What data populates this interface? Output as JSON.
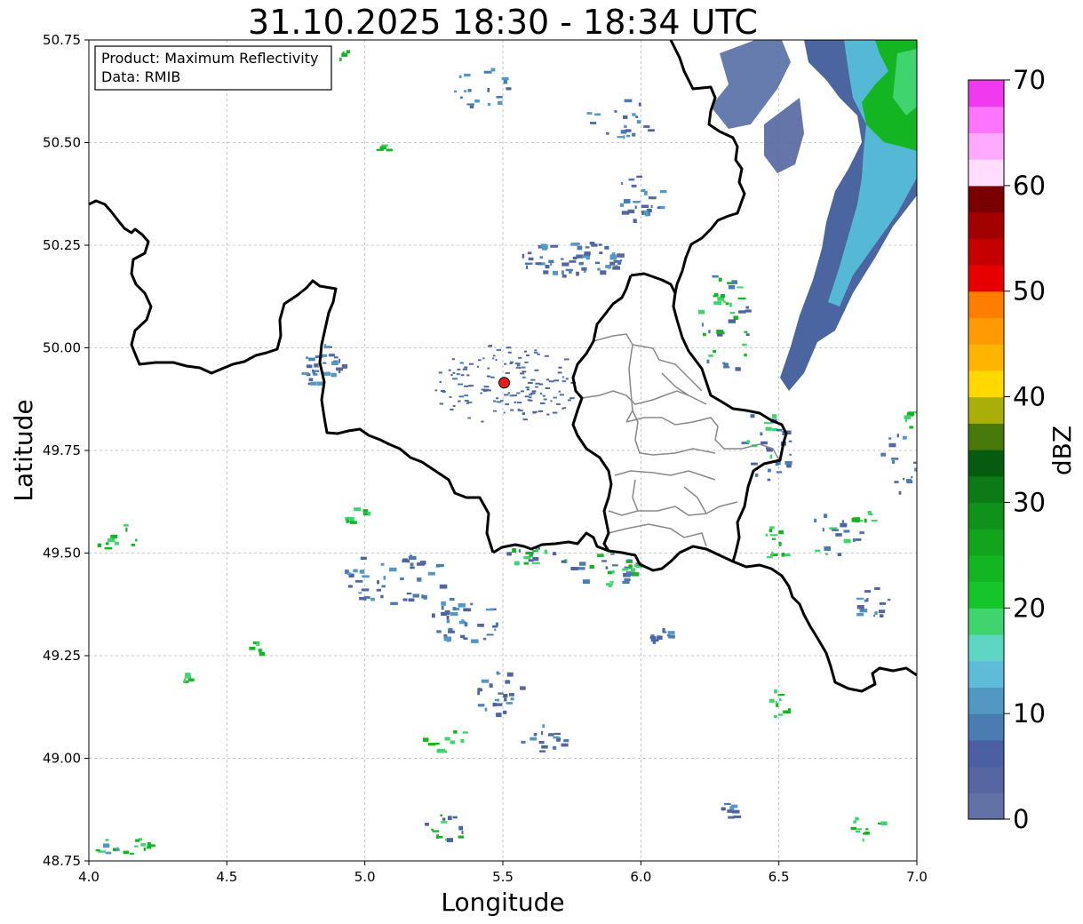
{
  "title": "31.10.2025 18:30 - 18:34 UTC",
  "info": {
    "product": "Product: Maximum Reflectivity",
    "data": "Data: RMIB"
  },
  "axes": {
    "xlabel": "Longitude",
    "ylabel": "Latitude",
    "xlim": [
      4.0,
      7.0
    ],
    "ylim": [
      48.75,
      50.75
    ],
    "xticks": [
      "4.0",
      "4.5",
      "5.0",
      "5.5",
      "6.0",
      "6.5",
      "7.0"
    ],
    "yticks": [
      "48.75",
      "49.00",
      "49.25",
      "49.50",
      "49.75",
      "50.00",
      "50.25",
      "50.50",
      "50.75"
    ],
    "grid": true
  },
  "radar_site": {
    "lon": 5.505,
    "lat": 49.915,
    "color": "#e41a1c"
  },
  "colorbar": {
    "label": "dBZ",
    "range": [
      0,
      70
    ],
    "ticks": [
      "0",
      "10",
      "20",
      "30",
      "40",
      "50",
      "60",
      "70"
    ],
    "colors": [
      "#6272a6",
      "#5566a0",
      "#4b60a2",
      "#4a7bb1",
      "#5398c2",
      "#5fbcd8",
      "#5ed6c4",
      "#3fd46e",
      "#14c629",
      "#13b622",
      "#12a41d",
      "#0f921a",
      "#0c7b16",
      "#075b0e",
      "#477a0a",
      "#aaae09",
      "#ffd800",
      "#ffb400",
      "#ff9a00",
      "#ff7e00",
      "#e60000",
      "#c40000",
      "#a30000",
      "#7a0000",
      "#ffddff",
      "#ffaaff",
      "#ff75ff",
      "#ef3aef"
    ]
  }
}
